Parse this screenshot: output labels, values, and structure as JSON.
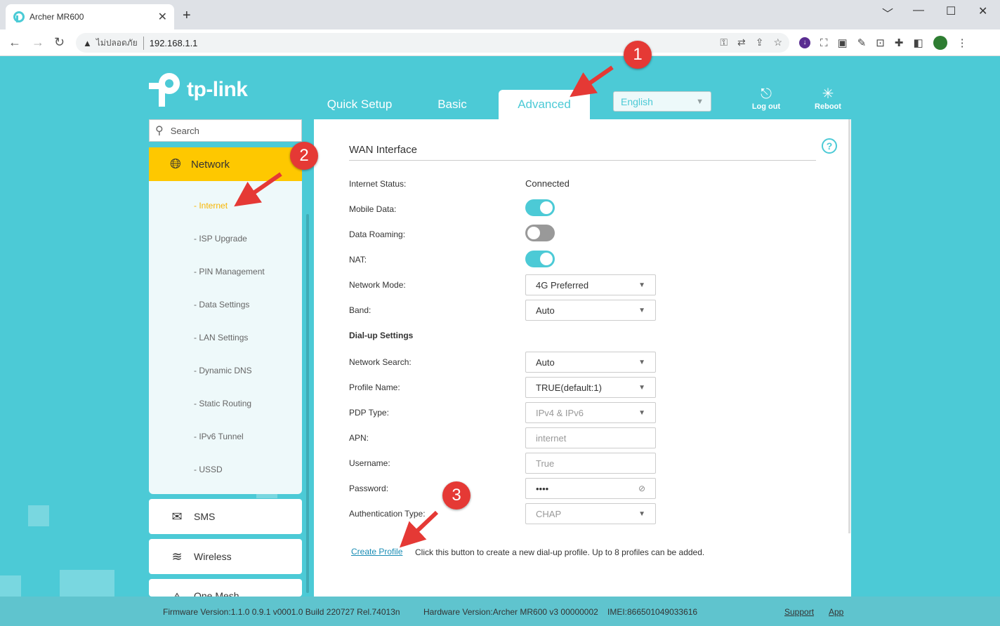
{
  "browser": {
    "tab_title": "Archer MR600",
    "tab_close": "✕",
    "new_tab": "+",
    "security_label": "ไม่ปลอดภัย",
    "url": "192.168.1.1",
    "window_controls": [
      "﹀",
      "—",
      "☐",
      "✕"
    ]
  },
  "brand": {
    "logo_text": "tp-link"
  },
  "top_nav": {
    "tabs": [
      {
        "label": "Quick Setup"
      },
      {
        "label": "Basic"
      },
      {
        "label": "Advanced"
      }
    ],
    "language": "English",
    "logout_label": "Log out",
    "reboot_label": "Reboot"
  },
  "sidebar": {
    "search_placeholder": "Search",
    "network": {
      "label": "Network",
      "items": [
        "- Internet",
        "- ISP Upgrade",
        "- PIN Management",
        "- Data Settings",
        "- LAN Settings",
        "- Dynamic DNS",
        "- Static Routing",
        "- IPv6 Tunnel",
        "- USSD"
      ]
    },
    "sms_label": "SMS",
    "wireless_label": "Wireless",
    "onemesh_label": "One Mesh"
  },
  "wan": {
    "title": "WAN Interface",
    "help": "?",
    "internet_status_label": "Internet Status:",
    "internet_status_value": "Connected",
    "mobile_data_label": "Mobile Data:",
    "mobile_data_on": true,
    "data_roaming_label": "Data Roaming:",
    "data_roaming_on": false,
    "nat_label": "NAT:",
    "nat_on": true,
    "network_mode_label": "Network Mode:",
    "network_mode_value": "4G Preferred",
    "band_label": "Band:",
    "band_value": "Auto",
    "dialup_heading": "Dial-up Settings",
    "network_search_label": "Network Search:",
    "network_search_value": "Auto",
    "profile_name_label": "Profile Name:",
    "profile_name_value": "TRUE(default:1)",
    "pdp_type_label": "PDP Type:",
    "pdp_type_value": "IPv4 & IPv6",
    "apn_label": "APN:",
    "apn_value": "internet",
    "username_label": "Username:",
    "username_value": "True",
    "password_label": "Password:",
    "password_value": "••••",
    "auth_type_label": "Authentication Type:",
    "auth_type_value": "CHAP",
    "create_profile_label": "Create Profile",
    "create_profile_desc": "Click this button to create a new dial-up profile. Up to 8 profiles can be added."
  },
  "footer": {
    "firmware": "Firmware Version:1.1.0 0.9.1 v0001.0 Build 220727 Rel.74013n",
    "hardware": "Hardware Version:Archer MR600 v3 00000002",
    "imei": "IMEI:866501049033616",
    "support_label": "Support",
    "app_label": "App"
  },
  "annotations": [
    "1",
    "2",
    "3"
  ],
  "colors": {
    "accent": "#4ccad6",
    "highlight": "#fec800",
    "annotation": "#e53935"
  }
}
